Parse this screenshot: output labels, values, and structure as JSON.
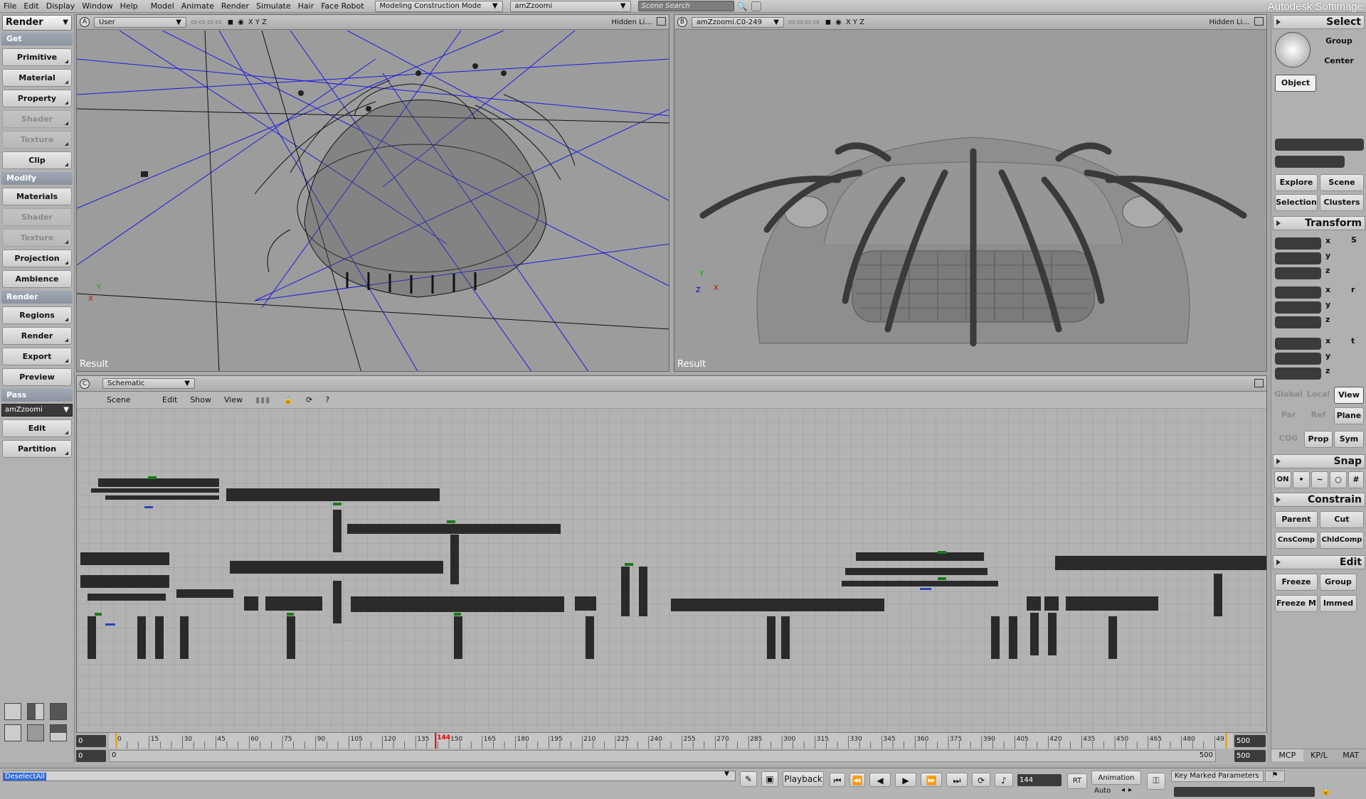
{
  "menubar": {
    "items": [
      "File",
      "Edit",
      "Display",
      "Window",
      "Help",
      "Model",
      "Animate",
      "Render",
      "Simulate",
      "Hair",
      "Face Robot"
    ],
    "mode_dropdown": "Modeling Construction Mode",
    "scene_dropdown": "amZzoomi",
    "scene_search_placeholder": "Scene Search",
    "brand": "Autodesk Softimage"
  },
  "left_panel": {
    "title": "Render",
    "sections": [
      {
        "label": "Get",
        "buttons": [
          [
            "Primitive",
            true
          ],
          [
            "Material",
            true
          ],
          [
            "Property",
            true
          ],
          [
            "Shader",
            false
          ],
          [
            "Texture",
            false
          ],
          [
            "Clip",
            true
          ]
        ]
      },
      {
        "label": "Modify",
        "buttons": [
          [
            "Materials",
            true
          ],
          [
            "Shader",
            false
          ],
          [
            "Texture",
            false
          ],
          [
            "Projection",
            true
          ],
          [
            "Ambience",
            true
          ]
        ]
      },
      {
        "label": "Render",
        "buttons": [
          [
            "Regions",
            true
          ],
          [
            "Render",
            true
          ],
          [
            "Export",
            true
          ],
          [
            "Preview",
            true
          ]
        ]
      },
      {
        "label": "Pass",
        "dropdown": "amZzoomi",
        "buttons": [
          [
            "Edit",
            true
          ],
          [
            "Partition",
            true
          ]
        ]
      }
    ]
  },
  "viewport_a": {
    "letter": "A",
    "camera": "User",
    "axes": "X Y Z",
    "display": "Hidden Li...",
    "result": "Result"
  },
  "viewport_b": {
    "letter": "B",
    "camera": "amZzoomi.C0-249",
    "axes": "X Y Z",
    "display": "Hidden Li...",
    "result": "Result"
  },
  "schematic": {
    "letter": "C",
    "title": "Schematic",
    "menus": [
      "Scene",
      "Edit",
      "Show",
      "View"
    ],
    "help": "?"
  },
  "right_panel": {
    "select": {
      "title": "Select",
      "group": "Group",
      "center": "Center",
      "object": "Object",
      "explore": "Explore",
      "scene": "Scene",
      "selection": "Selection",
      "clusters": "Clusters"
    },
    "transform": {
      "title": "Transform",
      "axes": [
        "x",
        "y",
        "z"
      ],
      "global": "Global",
      "local": "Local",
      "view": "View",
      "par": "Par",
      "ref": "Ref",
      "plane": "Plane",
      "cog": "COG",
      "prop": "Prop",
      "sym": "Sym"
    },
    "snap": {
      "title": "Snap",
      "on": "ON"
    },
    "constrain": {
      "title": "Constrain",
      "parent": "Parent",
      "cut": "Cut",
      "cnscomp": "CnsComp",
      "childcomp": "ChldComp"
    },
    "edit": {
      "title": "Edit",
      "freeze": "Freeze",
      "group": "Group",
      "freeze_m": "Freeze M",
      "immed": "Immed"
    },
    "tabs": [
      "MCP",
      "KP/L",
      "MAT"
    ]
  },
  "timeline": {
    "start": "0",
    "end": "500",
    "range_start": "0",
    "range_end": "500",
    "range_end_left": "500",
    "current_frame": "144",
    "ticks": [
      "0",
      "15",
      "30",
      "45",
      "60",
      "75",
      "90",
      "105",
      "120",
      "135",
      "150",
      "165",
      "180",
      "195",
      "210",
      "225",
      "240",
      "255",
      "270",
      "285",
      "300",
      "315",
      "330",
      "345",
      "360",
      "375",
      "390",
      "405",
      "420",
      "435",
      "450",
      "465",
      "480",
      "49"
    ]
  },
  "statusbar": {
    "command": "DeselectAll",
    "playback": "Playback",
    "frame": "144",
    "rt": "RT",
    "animation": "Animation",
    "auto": "Auto",
    "key_marked": "Key Marked Parameters"
  }
}
